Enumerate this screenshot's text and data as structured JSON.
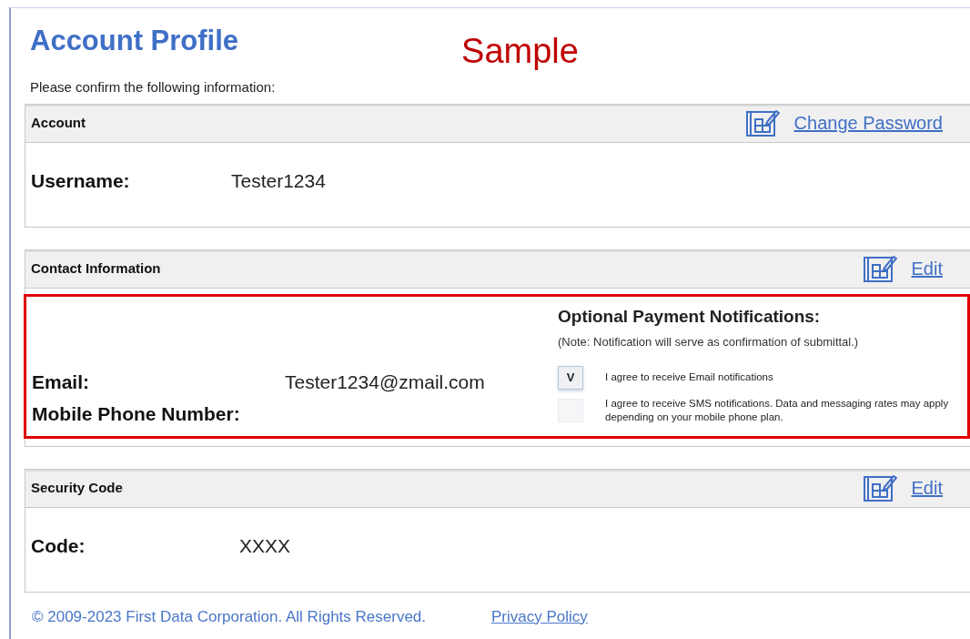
{
  "page": {
    "title": "Account Profile",
    "sample_label": "Sample",
    "intro": "Please confirm the following information:"
  },
  "sections": [
    {
      "kind": "account",
      "title": "Account",
      "action": "Change Password",
      "fields": [
        {
          "label": "Username:",
          "value": "Tester1234"
        }
      ]
    },
    {
      "kind": "contact",
      "title": "Contact Information",
      "action": "Edit",
      "highlighted": true,
      "fields": [
        {
          "label": "Email:",
          "value": "Tester1234@zmail.com"
        },
        {
          "label": "Mobile Phone Number:"
        }
      ],
      "notifications": {
        "title": "Optional Payment Notifications:",
        "note": "(Note:  Notification will serve as confirmation of submittal.)",
        "options": [
          {
            "checked": true,
            "mark": "V",
            "label": "I agree to receive Email notifications"
          },
          {
            "checked": false,
            "label": "I agree to receive SMS notifications. Data and messaging rates may apply depending on your mobile phone plan."
          }
        ]
      }
    },
    {
      "kind": "security",
      "title": "Security Code",
      "action": "Edit",
      "fields": [
        {
          "label": "Code:",
          "value": "XXXX"
        }
      ]
    }
  ],
  "footer": {
    "copyright": "© 2009-2023 First Data Corporation. All Rights Reserved.",
    "link": "Privacy Policy"
  }
}
